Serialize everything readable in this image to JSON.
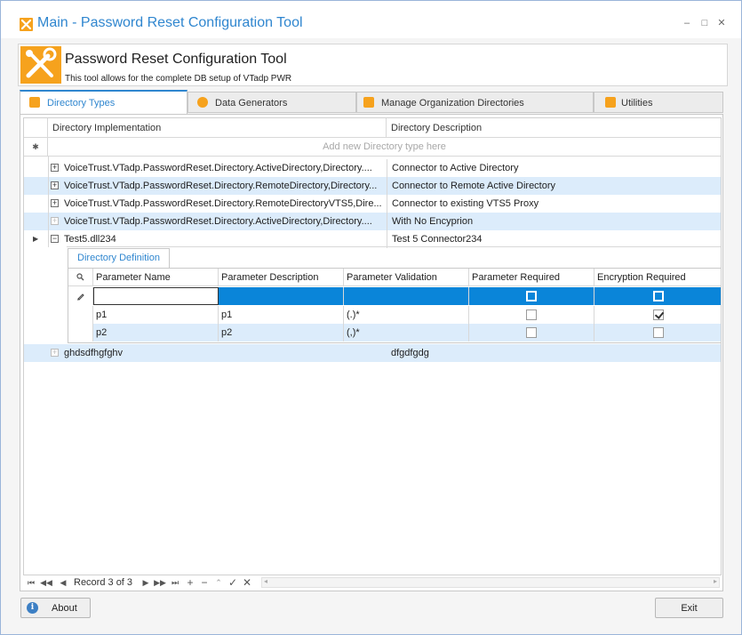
{
  "window": {
    "title": "Main - Password Reset Configuration Tool",
    "minimize_glyph": "–",
    "maximize_glyph": "□",
    "close_glyph": "✕"
  },
  "header": {
    "title": "Password Reset Configuration Tool",
    "subtitle": "This tool allows for the complete DB setup of VTadp PWR"
  },
  "tabs": [
    {
      "label": "Directory Types",
      "icon": "directory-types-icon",
      "active": true
    },
    {
      "label": "Data Generators",
      "icon": "data-generators-icon",
      "active": false
    },
    {
      "label": "Manage Organization Directories",
      "icon": "manage-directories-icon",
      "active": false
    },
    {
      "label": "Utilities",
      "icon": "utilities-icon",
      "active": false
    }
  ],
  "grid": {
    "columns": [
      "Directory Implementation",
      "Directory Description"
    ],
    "new_row_text": "Add new Directory type here",
    "rows": [
      {
        "implementation": "VoiceTrust.VTadp.PasswordReset.Directory.ActiveDirectory,Directory....",
        "description": "Connector to Active Directory"
      },
      {
        "implementation": "VoiceTrust.VTadp.PasswordReset.Directory.RemoteDirectory,Directory...",
        "description": "Connector to Remote Active Directory"
      },
      {
        "implementation": "VoiceTrust.VTadp.PasswordReset.Directory.RemoteDirectoryVTS5,Dire...",
        "description": "Connector to existing VTS5 Proxy"
      },
      {
        "implementation": "VoiceTrust.VTadp.PasswordReset.Directory.ActiveDirectory,Directory....",
        "description": "With No Encyprion"
      },
      {
        "implementation": "Test5.dll234",
        "description": "Test 5 Connector234"
      },
      {
        "implementation": "ghdsdfhgfghv",
        "description": "dfgdfgdg"
      }
    ]
  },
  "detail": {
    "tab_label": "Directory Definition",
    "columns": [
      "Parameter Name",
      "Parameter Description",
      "Parameter Validation",
      "Parameter Required",
      "Encryption Required"
    ],
    "rows": [
      {
        "name": "p1",
        "description": "p1",
        "validation": "(.)*",
        "required": false,
        "encryption": true
      },
      {
        "name": "p2",
        "description": "p2",
        "validation": "(,)*",
        "required": false,
        "encryption": false
      }
    ]
  },
  "navigator": {
    "record_text": "Record 3 of 3"
  },
  "buttons": {
    "about": "About",
    "exit": "Exit"
  },
  "colors": {
    "accent": "#2f86cf",
    "brand_orange": "#f6a21d",
    "selection": "#0a85d9",
    "alt_row": "#dcecfb"
  }
}
